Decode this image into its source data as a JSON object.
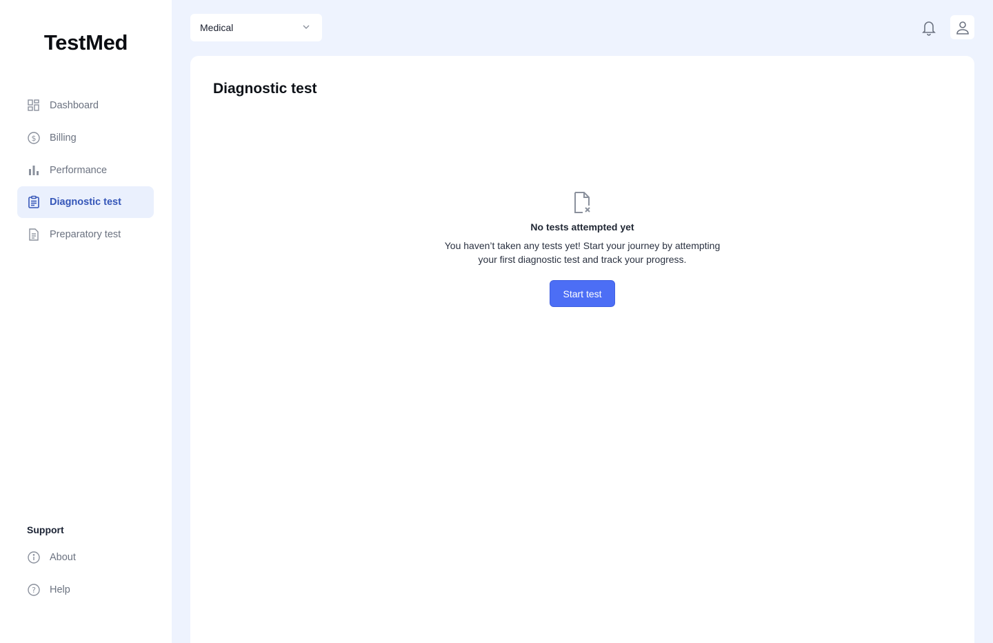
{
  "brand": "TestMed",
  "nav": [
    {
      "label": "Dashboard",
      "icon": "dashboard-icon"
    },
    {
      "label": "Billing",
      "icon": "dollar-circle-icon"
    },
    {
      "label": "Performance",
      "icon": "bar-chart-icon"
    },
    {
      "label": "Diagnostic test",
      "icon": "clipboard-icon",
      "active": true
    },
    {
      "label": "Preparatory test",
      "icon": "document-icon"
    }
  ],
  "support": {
    "title": "Support",
    "items": [
      {
        "label": "About",
        "icon": "info-circle-icon"
      },
      {
        "label": "Help",
        "icon": "question-circle-icon"
      }
    ]
  },
  "topbar": {
    "category_select": "Medical"
  },
  "main": {
    "title": "Diagnostic test",
    "empty_state": {
      "title": "No tests attempted yet",
      "description": "You haven’t taken any tests yet! Start your journey by attempting your first diagnostic test and track your progress.",
      "button": "Start test"
    }
  },
  "colors": {
    "accent": "#4c6ef5",
    "active_nav_bg": "#eaf0fd",
    "active_nav_text": "#3556b8",
    "page_bg": "#eef3fe"
  }
}
